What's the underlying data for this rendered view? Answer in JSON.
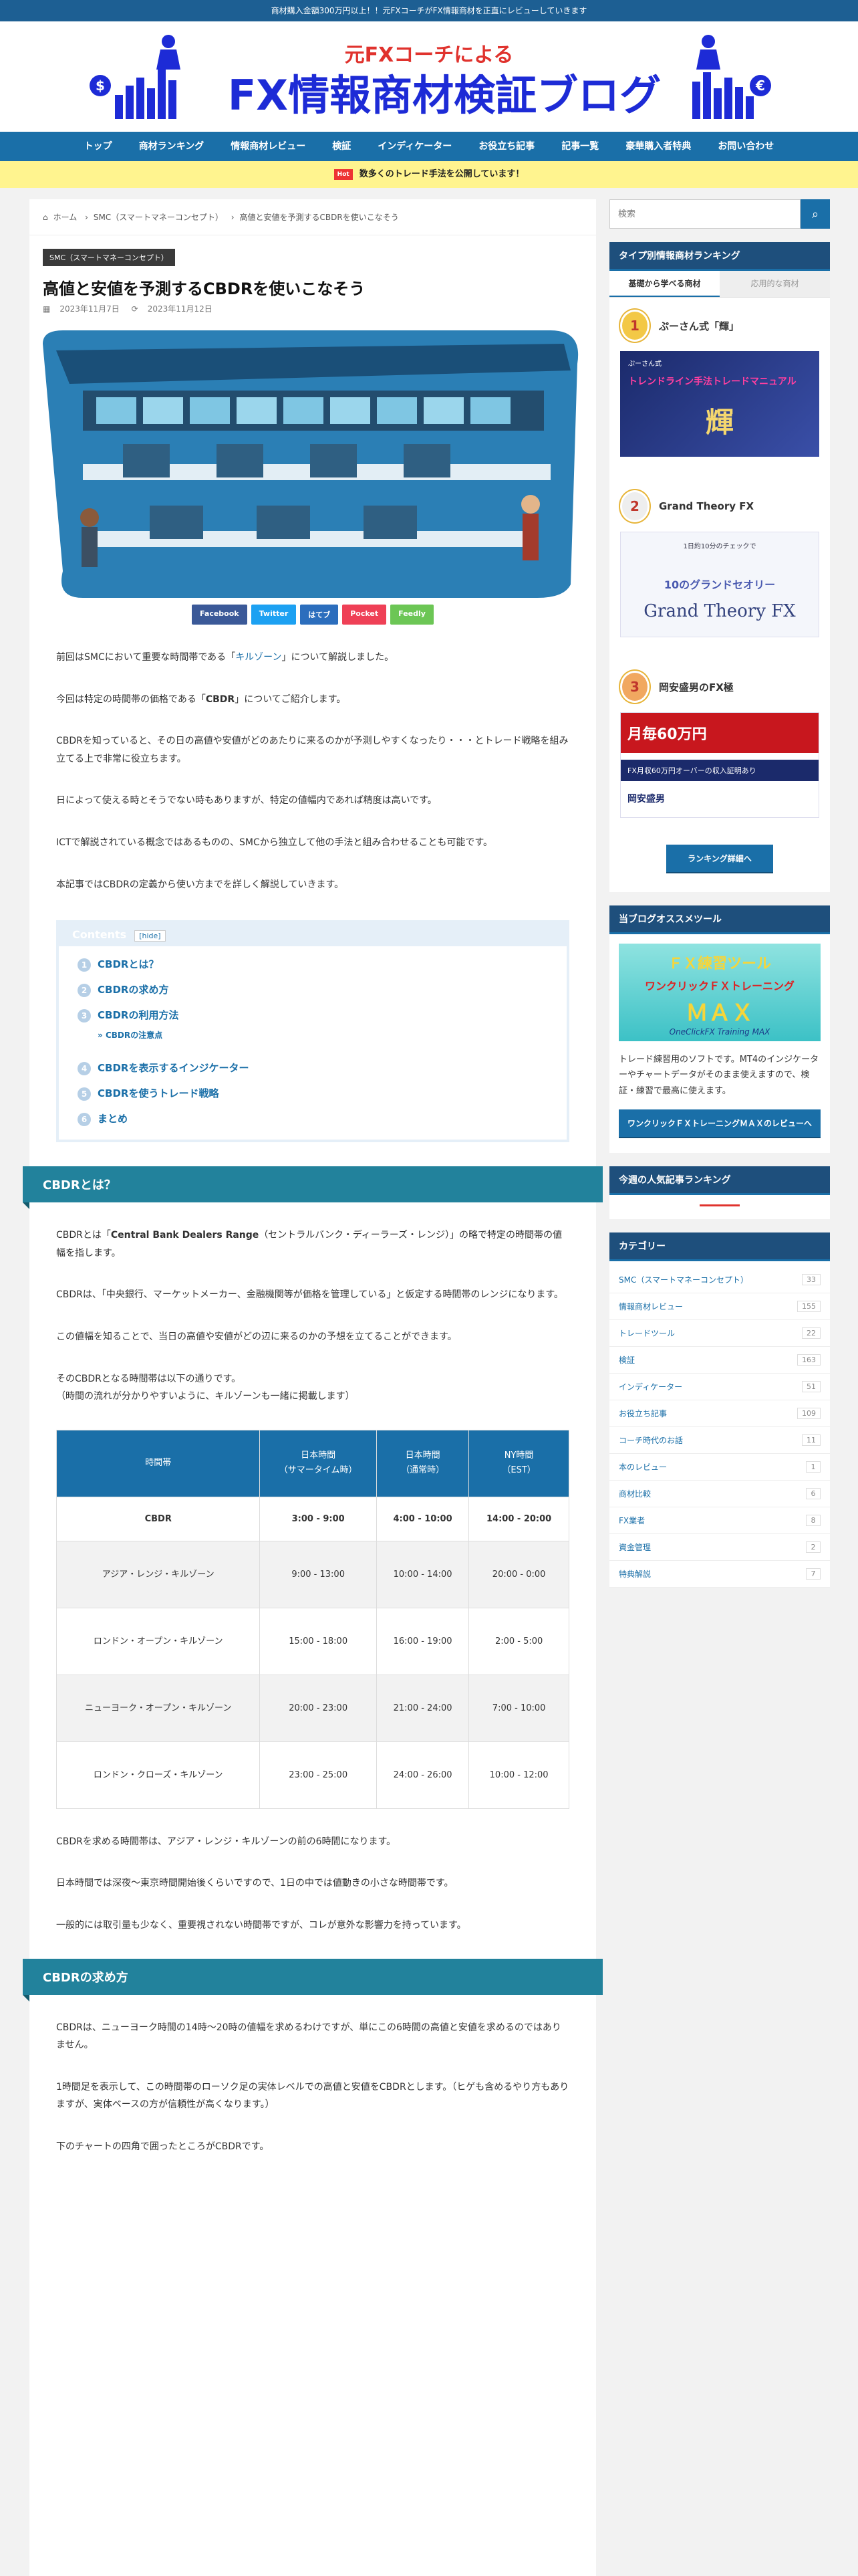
{
  "topbar": {
    "text": "商材購入金額300万円以上！！元FXコーチがFX情報商材を正直にレビューしていきます"
  },
  "header": {
    "sub": "元FXコーチによる",
    "title": "FX情報商材検証ブログ"
  },
  "nav": [
    "トップ",
    "商材ランキング",
    "情報商材レビュー",
    "検証",
    "インディケーター",
    "お役立ち記事",
    "記事一覧",
    "豪華購入者特典",
    "お問い合わせ"
  ],
  "notice": {
    "badge": "Hot",
    "text": "数多くのトレード手法を公開しています！"
  },
  "breadcrumb": [
    "ホーム",
    "SMC（スマートマネーコンセプト）",
    "高値と安値を予測するCBDRを使いこなそう"
  ],
  "article": {
    "category": "SMC（スマートマネーコンセプト）",
    "title": "高値と安値を予測するCBDRを使いこなそう",
    "published": "2023年11月7日",
    "updated": "2023年11月12日",
    "share": [
      "Facebook",
      "Twitter",
      "はてブ",
      "Pocket",
      "Feedly"
    ],
    "intro": {
      "p1a": "前回はSMCにおいて重要な時間帯である「",
      "p1link": "キルゾーン",
      "p1b": "」について解説しました。",
      "p2a": "今回は特定の時間帯の価格である「",
      "p2b": "CBDR",
      "p2c": "」についてご紹介します。",
      "p3": "CBDRを知っていると、その日の高値や安値がどのあたりに来るのかが予測しやすくなったり・・・とトレード戦略を組み立てる上で非常に役立ちます。",
      "p4": "日によって使える時とそうでない時もありますが、特定の値幅内であれば精度は高いです。",
      "p5": "ICTで解説されている概念ではあるものの、SMCから独立して他の手法と組み合わせることも可能です。",
      "p6": "本記事ではCBDRの定義から使い方までを詳しく解説していきます。"
    },
    "toc": {
      "title": "Contents",
      "hide": "hide",
      "items": [
        "CBDRとは？",
        "CBDRの求め方",
        "CBDRの利用方法",
        "CBDRの注意点",
        "CBDRを表示するインジケーター",
        "CBDRを使うトレード戦略",
        "まとめ"
      ],
      "nums": [
        "1",
        "2",
        "3",
        "4",
        "5",
        "6"
      ]
    },
    "s1": {
      "heading": "CBDRとは？",
      "p1a": "CBDRとは「",
      "p1b": "Central Bank Dealers Range",
      "p1c": "（セントラルバンク・ディーラーズ・レンジ）」の略で特定の時間帯の値幅を指します。",
      "p2": "CBDRは、「中央銀行、マーケットメーカー、金融機関等が価格を管理している」と仮定する時間帯のレンジになります。",
      "p3": "この値幅を知ることで、当日の高値や安値がどの辺に来るのかの予想を立てることができます。",
      "p4a": "そのCBDRとなる時間帯は以下の通りです。",
      "p4b": "（時間の流れが分かりやすいように、キルゾーンも一緒に掲載します）",
      "table": {
        "headers": [
          [
            "時間帯"
          ],
          [
            "日本時間",
            "（サマータイム時）"
          ],
          [
            "日本時間",
            "（通常時）"
          ],
          [
            "NY時間",
            "（EST）"
          ]
        ],
        "rows": [
          [
            "CBDR",
            "3:00 - 9:00",
            "4:00 - 10:00",
            "14:00 - 20:00"
          ],
          [
            "アジア・レンジ・キルゾーン",
            "9:00 - 13:00",
            "10:00 - 14:00",
            "20:00 - 0:00"
          ],
          [
            "ロンドン・オープン・キルゾーン",
            "15:00 - 18:00",
            "16:00 - 19:00",
            "2:00 - 5:00"
          ],
          [
            "ニューヨーク・オープン・キルゾーン",
            "20:00 - 23:00",
            "21:00 - 24:00",
            "7:00 - 10:00"
          ],
          [
            "ロンドン・クローズ・キルゾーン",
            "23:00 - 25:00",
            "24:00 - 26:00",
            "10:00 - 12:00"
          ]
        ]
      },
      "p5": "CBDRを求める時間帯は、アジア・レンジ・キルゾーンの前の6時間になります。",
      "p6": "日本時間では深夜～東京時間開始後くらいですので、1日の中では値動きの小さな時間帯です。",
      "p7": "一般的には取引量も少なく、重要視されない時間帯ですが、コレが意外な影響力を持っています。"
    },
    "s2": {
      "heading": "CBDRの求め方",
      "p1": "CBDRは、ニューヨーク時間の14時～20時の値幅を求めるわけですが、単にこの6時間の高値と安値を求めるのではありません。",
      "p2": "1時間足を表示して、この時間帯のローソク足の実体レベルでの高値と安値をCBDRとします。（ヒゲも含めるやり方もありますが、実体ベースの方が信頼性が高くなります。）",
      "p3": "下のチャートの四角で囲ったところがCBDRです。"
    }
  },
  "sidebar": {
    "search_placeholder": "検索",
    "ranking_title": "タイプ別情報商材ランキング",
    "tabs": [
      "基礎から学べる商材",
      "応用的な商材"
    ],
    "ranks": [
      {
        "num": "1",
        "name": "ぷーさん式「輝」",
        "img_small": "ぷーさん式",
        "img_big": "トレンドライン手法トレードマニュアル",
        "img_mark": "輝"
      },
      {
        "num": "2",
        "name": "Grand Theory FX",
        "img_small": "1日約10分のチェックで",
        "img_big": "10のグランドセオリー",
        "img_mark": "Grand Theory FX"
      },
      {
        "num": "3",
        "name": "岡安盛男のFX極",
        "img_small": "月毎60万円",
        "img_big": "FX月収60万円オーバーの収入証明あり",
        "img_mark": "岡安盛男"
      }
    ],
    "ranking_button": "ランキング詳細へ",
    "tool_title": "当ブログオススメツール",
    "tool_img": {
      "line1": "ＦＸ練習ツール",
      "line2": "ワンクリックＦＸトレーニング",
      "line3": "ＭＡＸ",
      "line4": "OneClickFX Training MAX"
    },
    "tool_text": "トレード練習用のソフトです。MT4のインジケーターやチャートデータがそのまま使えますので、検証・練習で最高に使えます。",
    "tool_button": "ワンクリックＦＸトレーニングＭＡＸのレビューへ",
    "weekly_title": "今週の人気記事ランキング",
    "category_title": "カテゴリー",
    "categories": [
      {
        "name": "SMC（スマートマネーコンセプト）",
        "count": "33"
      },
      {
        "name": "情報商材レビュー",
        "count": "155"
      },
      {
        "name": "トレードツール",
        "count": "22"
      },
      {
        "name": "検証",
        "count": "163"
      },
      {
        "name": "インディケーター",
        "count": "51"
      },
      {
        "name": "お役立ち記事",
        "count": "109"
      },
      {
        "name": "コーチ時代のお話",
        "count": "11"
      },
      {
        "name": "本のレビュー",
        "count": "1"
      },
      {
        "name": "商材比較",
        "count": "6"
      },
      {
        "name": "FX業者",
        "count": "8"
      },
      {
        "name": "資金管理",
        "count": "2"
      },
      {
        "name": "特典解説",
        "count": "7"
      }
    ]
  },
  "colors": {
    "primary": "#1a6fa8",
    "heading": "#22829c",
    "sidebar_head": "#1e4f7c"
  }
}
